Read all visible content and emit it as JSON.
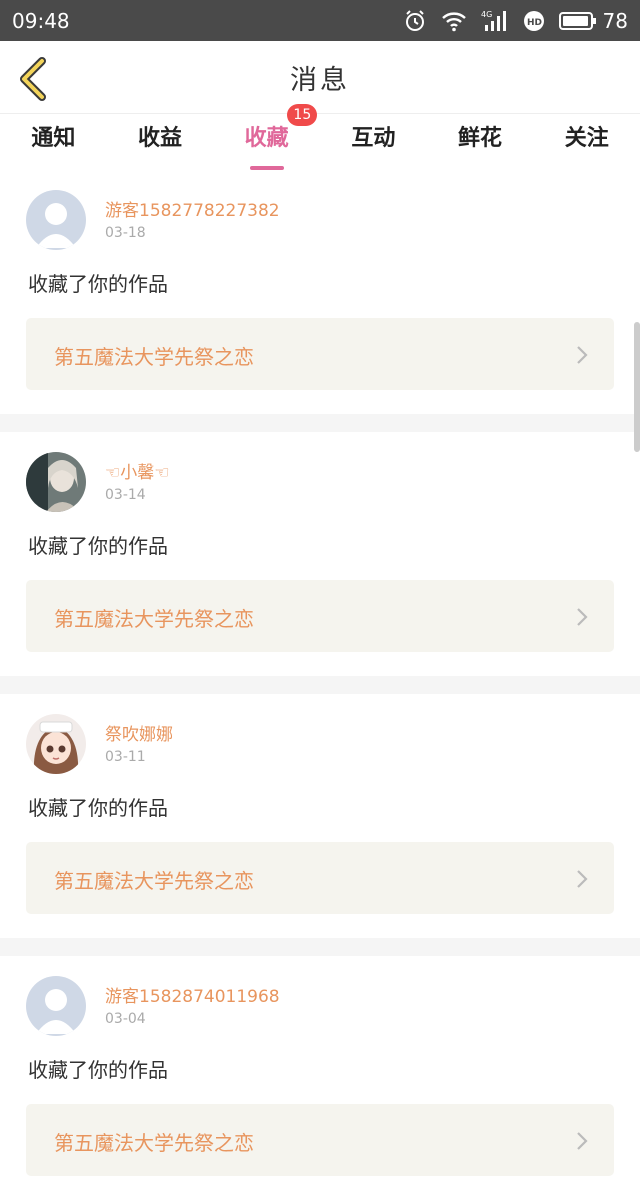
{
  "status_bar": {
    "time": "09:48",
    "battery": "78"
  },
  "header": {
    "title": "消息"
  },
  "tabs": [
    {
      "label": "通知",
      "active": false
    },
    {
      "label": "收益",
      "active": false
    },
    {
      "label": "收藏",
      "active": true,
      "badge": "15"
    },
    {
      "label": "互动",
      "active": false
    },
    {
      "label": "鲜花",
      "active": false
    },
    {
      "label": "关注",
      "active": false
    }
  ],
  "messages": [
    {
      "username": "游客1582778227382",
      "date": "03-18",
      "action": "收藏了你的作品",
      "work_title": "第五魔法大学先祭之恋",
      "avatar": "default-avatar"
    },
    {
      "username": "☜小馨☜",
      "date": "03-14",
      "action": "收藏了你的作品",
      "work_title": "第五魔法大学先祭之恋",
      "avatar": "doll-avatar"
    },
    {
      "username": "祭吹娜娜",
      "date": "03-11",
      "action": "收藏了你的作品",
      "work_title": "第五魔法大学先祭之恋",
      "avatar": "anime-girl-avatar"
    },
    {
      "username": "游客1582874011968",
      "date": "03-04",
      "action": "收藏了你的作品",
      "work_title": "第五魔法大学先祭之恋",
      "avatar": "default-avatar"
    }
  ],
  "colors": {
    "accent": "#e0689a",
    "username": "#e8955e",
    "badge": "#f04a4a",
    "work_box": "#f5f4ee"
  }
}
